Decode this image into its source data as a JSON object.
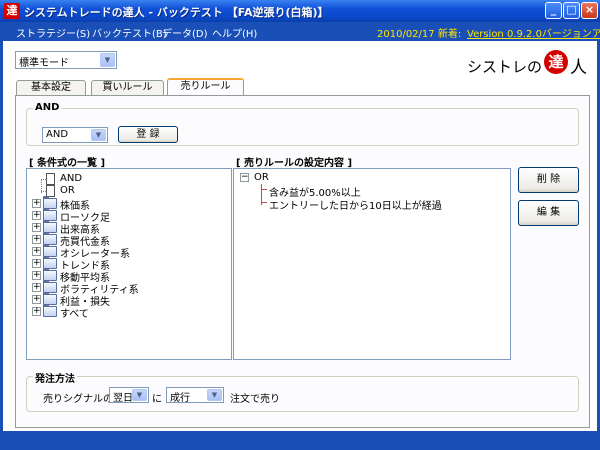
{
  "window": {
    "title": "システムトレードの達人 - バックテスト 【FA逆張り(白箱)】",
    "app_icon_char": "達",
    "minimize_glyph": "_",
    "maximize_glyph": "□",
    "close_glyph": "×"
  },
  "menu": {
    "items": [
      "ストラテジー(S)",
      "バックテスト(B)",
      "データ(D)",
      "ヘルプ(H)"
    ],
    "date_info": "2010/02/17 新着:",
    "version_link": "Version 0.9.2.0バージョンアッ"
  },
  "mode": {
    "selected": "標準モード"
  },
  "logo": {
    "text": "シストレの",
    "badge_char": "達",
    "suffix": "人"
  },
  "tabs": [
    {
      "label": "基本設定",
      "active": false
    },
    {
      "label": "買いルール",
      "active": false
    },
    {
      "label": "売りルール",
      "active": true
    }
  ],
  "and_group": {
    "label": "AND",
    "selected": "AND",
    "register_button": "登 録"
  },
  "condition_list": {
    "heading": "[ 条件式の一覧 ]",
    "operators": [
      "AND",
      "OR"
    ],
    "folders": [
      "株価系",
      "ローソク足",
      "出来高系",
      "売買代金系",
      "オシレーター系",
      "トレンド系",
      "移動平均系",
      "ボラティリティ系",
      "利益・損失",
      "すべて"
    ]
  },
  "rule_settings": {
    "heading": "[ 売りルールの設定内容 ]",
    "collapse_glyph": "−",
    "root": "OR",
    "children": [
      "含み益が5.00%以上",
      "エントリーした日から10日以上が経過"
    ]
  },
  "buttons": {
    "delete": "削 除",
    "edit": "編 集"
  },
  "order": {
    "group_label": "発注方法",
    "prefix": "売りシグナルの",
    "timing": "翌日",
    "particle": "に",
    "order_type": "成行",
    "suffix": "注文で売り"
  },
  "icons": {
    "dropdown": "▼",
    "expand": "+"
  }
}
